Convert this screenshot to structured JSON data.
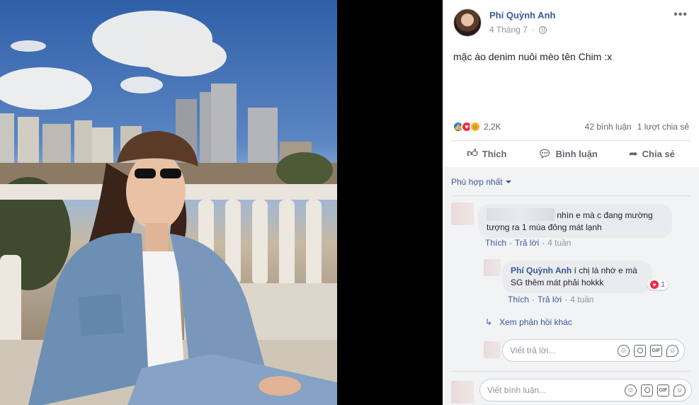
{
  "post": {
    "author": "Phí Quỳnh Anh",
    "date": "4 Tháng 7",
    "caption": "mặc áo denim nuôi mèo tên Chim :x",
    "more_icon": "more-horizontal-icon",
    "privacy_icon": "globe-icon"
  },
  "reactions": {
    "count": "2,2K",
    "comments": "42 bình luận",
    "shares": "1 lượt chia sẻ",
    "types": [
      "like",
      "love",
      "haha"
    ]
  },
  "actions": {
    "like": "Thích",
    "comment": "Bình luận",
    "share": "Chia sẻ"
  },
  "comments": {
    "sort_label": "Phù hợp nhất",
    "items": [
      {
        "text_line1": "nhìn e mà c đang mường",
        "text_line2": "tượng ra 1 mùa đông mát lạnh",
        "like": "Thích",
        "reply": "Trả lời",
        "time": "4 tuần"
      }
    ],
    "reply": {
      "author": "Phí Quỳnh Anh",
      "text_line1": "í chị là nhờ e mà",
      "text_line2": "SG thêm mát phải hokkk",
      "reaction_count": "1",
      "like": "Thích",
      "reply": "Trả lời",
      "time": "4 tuần"
    },
    "more_replies": "Xem phản hồi khác",
    "reply_placeholder": "Viết trả lời...",
    "comment_placeholder": "Viết bình luận..."
  },
  "colors": {
    "link_blue": "#385898",
    "love_red": "#f0284a",
    "like_blue": "#1877f2"
  }
}
